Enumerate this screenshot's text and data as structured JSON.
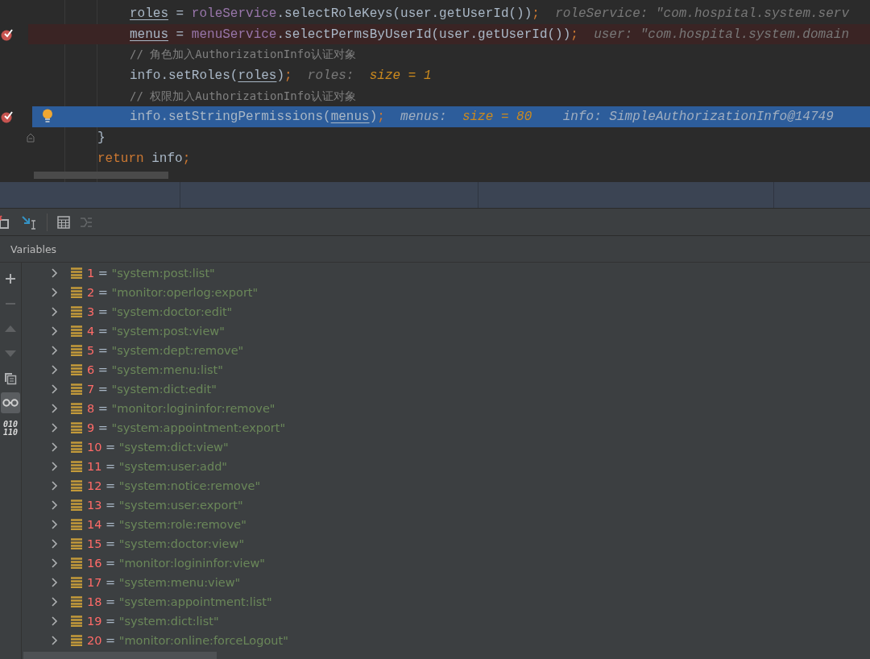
{
  "editor": {
    "inner_lines": [
      {
        "kind": "normal",
        "breakpoint": false,
        "bulb": false,
        "fold": false,
        "tokens": [
          {
            "kind": "var",
            "text": "roles"
          },
          {
            "kind": "plain",
            "text": " = "
          },
          {
            "kind": "field",
            "text": "roleService"
          },
          {
            "kind": "plain",
            "text": ".selectRoleKeys(user.getUserId())"
          },
          {
            "kind": "punct",
            "text": ";"
          },
          {
            "kind": "hint",
            "text": "roleService: \"com.hospital.system.serv"
          }
        ]
      },
      {
        "kind": "breakpoint",
        "breakpoint": true,
        "bulb": false,
        "fold": false,
        "tokens": [
          {
            "kind": "var",
            "text": "menus"
          },
          {
            "kind": "plain",
            "text": " = "
          },
          {
            "kind": "field",
            "text": "menuService"
          },
          {
            "kind": "plain",
            "text": ".selectPermsByUserId(user.getUserId())"
          },
          {
            "kind": "punct",
            "text": ";"
          },
          {
            "kind": "hint",
            "text": "user: \"com.hospital.system.domain"
          }
        ]
      },
      {
        "kind": "normal",
        "breakpoint": false,
        "bulb": false,
        "fold": false,
        "tokens": [
          {
            "kind": "comment",
            "text": "// 角色加入AuthorizationInfo认证对象"
          }
        ]
      },
      {
        "kind": "normal",
        "breakpoint": false,
        "bulb": false,
        "fold": false,
        "tokens": [
          {
            "kind": "plain",
            "text": "info.setRoles("
          },
          {
            "kind": "var",
            "text": "roles"
          },
          {
            "kind": "plain",
            "text": ")"
          },
          {
            "kind": "punct",
            "text": ";"
          },
          {
            "kind": "hint",
            "text": "roles:"
          },
          {
            "kind": "hintval",
            "text": "size = 1"
          }
        ]
      },
      {
        "kind": "normal",
        "breakpoint": false,
        "bulb": false,
        "fold": false,
        "tokens": [
          {
            "kind": "comment",
            "text": "// 权限加入AuthorizationInfo认证对象"
          }
        ]
      },
      {
        "kind": "execution",
        "breakpoint": true,
        "bulb": true,
        "fold": false,
        "tokens": [
          {
            "kind": "plain",
            "text": "info.setStringPermissions("
          },
          {
            "kind": "var",
            "text": "menus"
          },
          {
            "kind": "plain",
            "text": ")"
          },
          {
            "kind": "punct",
            "text": ";"
          },
          {
            "kind": "hint",
            "text": "menus:"
          },
          {
            "kind": "hintval",
            "text": "size = 80"
          },
          {
            "kind": "hint",
            "text": "info: SimpleAuthorizationInfo@14749"
          }
        ]
      }
    ],
    "outer_lines": [
      {
        "breakpoint": false,
        "bulb": false,
        "fold": true,
        "tokens": [
          {
            "kind": "plain",
            "text": "}"
          }
        ]
      },
      {
        "breakpoint": false,
        "bulb": false,
        "fold": false,
        "tokens": [
          {
            "kind": "keyword",
            "text": "return"
          },
          {
            "kind": "plain",
            "text": " info"
          },
          {
            "kind": "punct",
            "text": ";"
          }
        ]
      }
    ]
  },
  "toolbar": [
    {
      "kind": "restore",
      "disabled": false
    },
    {
      "kind": "step-to-cursor",
      "disabled": false
    },
    {
      "kind": "separator"
    },
    {
      "kind": "evaluate",
      "disabled": false
    },
    {
      "kind": "trace",
      "disabled": true
    }
  ],
  "variables": {
    "title": "Variables",
    "side_tools": [
      {
        "kind": "plus",
        "disabled": false
      },
      {
        "kind": "minus",
        "disabled": true
      },
      {
        "kind": "up",
        "disabled": true
      },
      {
        "kind": "down",
        "disabled": true
      },
      {
        "kind": "copy",
        "disabled": false
      },
      {
        "kind": "watches",
        "disabled": false,
        "on": true
      },
      {
        "kind": "binary",
        "label": [
          "010",
          "110"
        ],
        "disabled": false,
        "on": false
      }
    ],
    "items": [
      {
        "index": "1",
        "operator": "=",
        "value": "\"system:post:list\"",
        "expanded": false
      },
      {
        "index": "2",
        "operator": "=",
        "value": "\"monitor:operlog:export\"",
        "expanded": false
      },
      {
        "index": "3",
        "operator": "=",
        "value": "\"system:doctor:edit\"",
        "expanded": false
      },
      {
        "index": "4",
        "operator": "=",
        "value": "\"system:post:view\"",
        "expanded": false
      },
      {
        "index": "5",
        "operator": "=",
        "value": "\"system:dept:remove\"",
        "expanded": false
      },
      {
        "index": "6",
        "operator": "=",
        "value": "\"system:menu:list\"",
        "expanded": false
      },
      {
        "index": "7",
        "operator": "=",
        "value": "\"system:dict:edit\"",
        "expanded": false
      },
      {
        "index": "8",
        "operator": "=",
        "value": "\"monitor:logininfor:remove\"",
        "expanded": false
      },
      {
        "index": "9",
        "operator": "=",
        "value": "\"system:appointment:export\"",
        "expanded": false
      },
      {
        "index": "10",
        "operator": "=",
        "value": "\"system:dict:view\"",
        "expanded": false
      },
      {
        "index": "11",
        "operator": "=",
        "value": "\"system:user:add\"",
        "expanded": false
      },
      {
        "index": "12",
        "operator": "=",
        "value": "\"system:notice:remove\"",
        "expanded": false
      },
      {
        "index": "13",
        "operator": "=",
        "value": "\"system:user:export\"",
        "expanded": false
      },
      {
        "index": "14",
        "operator": "=",
        "value": "\"system:role:remove\"",
        "expanded": false
      },
      {
        "index": "15",
        "operator": "=",
        "value": "\"system:doctor:view\"",
        "expanded": false
      },
      {
        "index": "16",
        "operator": "=",
        "value": "\"monitor:logininfor:view\"",
        "expanded": false
      },
      {
        "index": "17",
        "operator": "=",
        "value": "\"system:menu:view\"",
        "expanded": false
      },
      {
        "index": "18",
        "operator": "=",
        "value": "\"system:appointment:list\"",
        "expanded": false
      },
      {
        "index": "19",
        "operator": "=",
        "value": "\"system:dict:list\"",
        "expanded": false
      },
      {
        "index": "20",
        "operator": "=",
        "value": "\"monitor:online:forceLogout\"",
        "expanded": false
      }
    ]
  }
}
